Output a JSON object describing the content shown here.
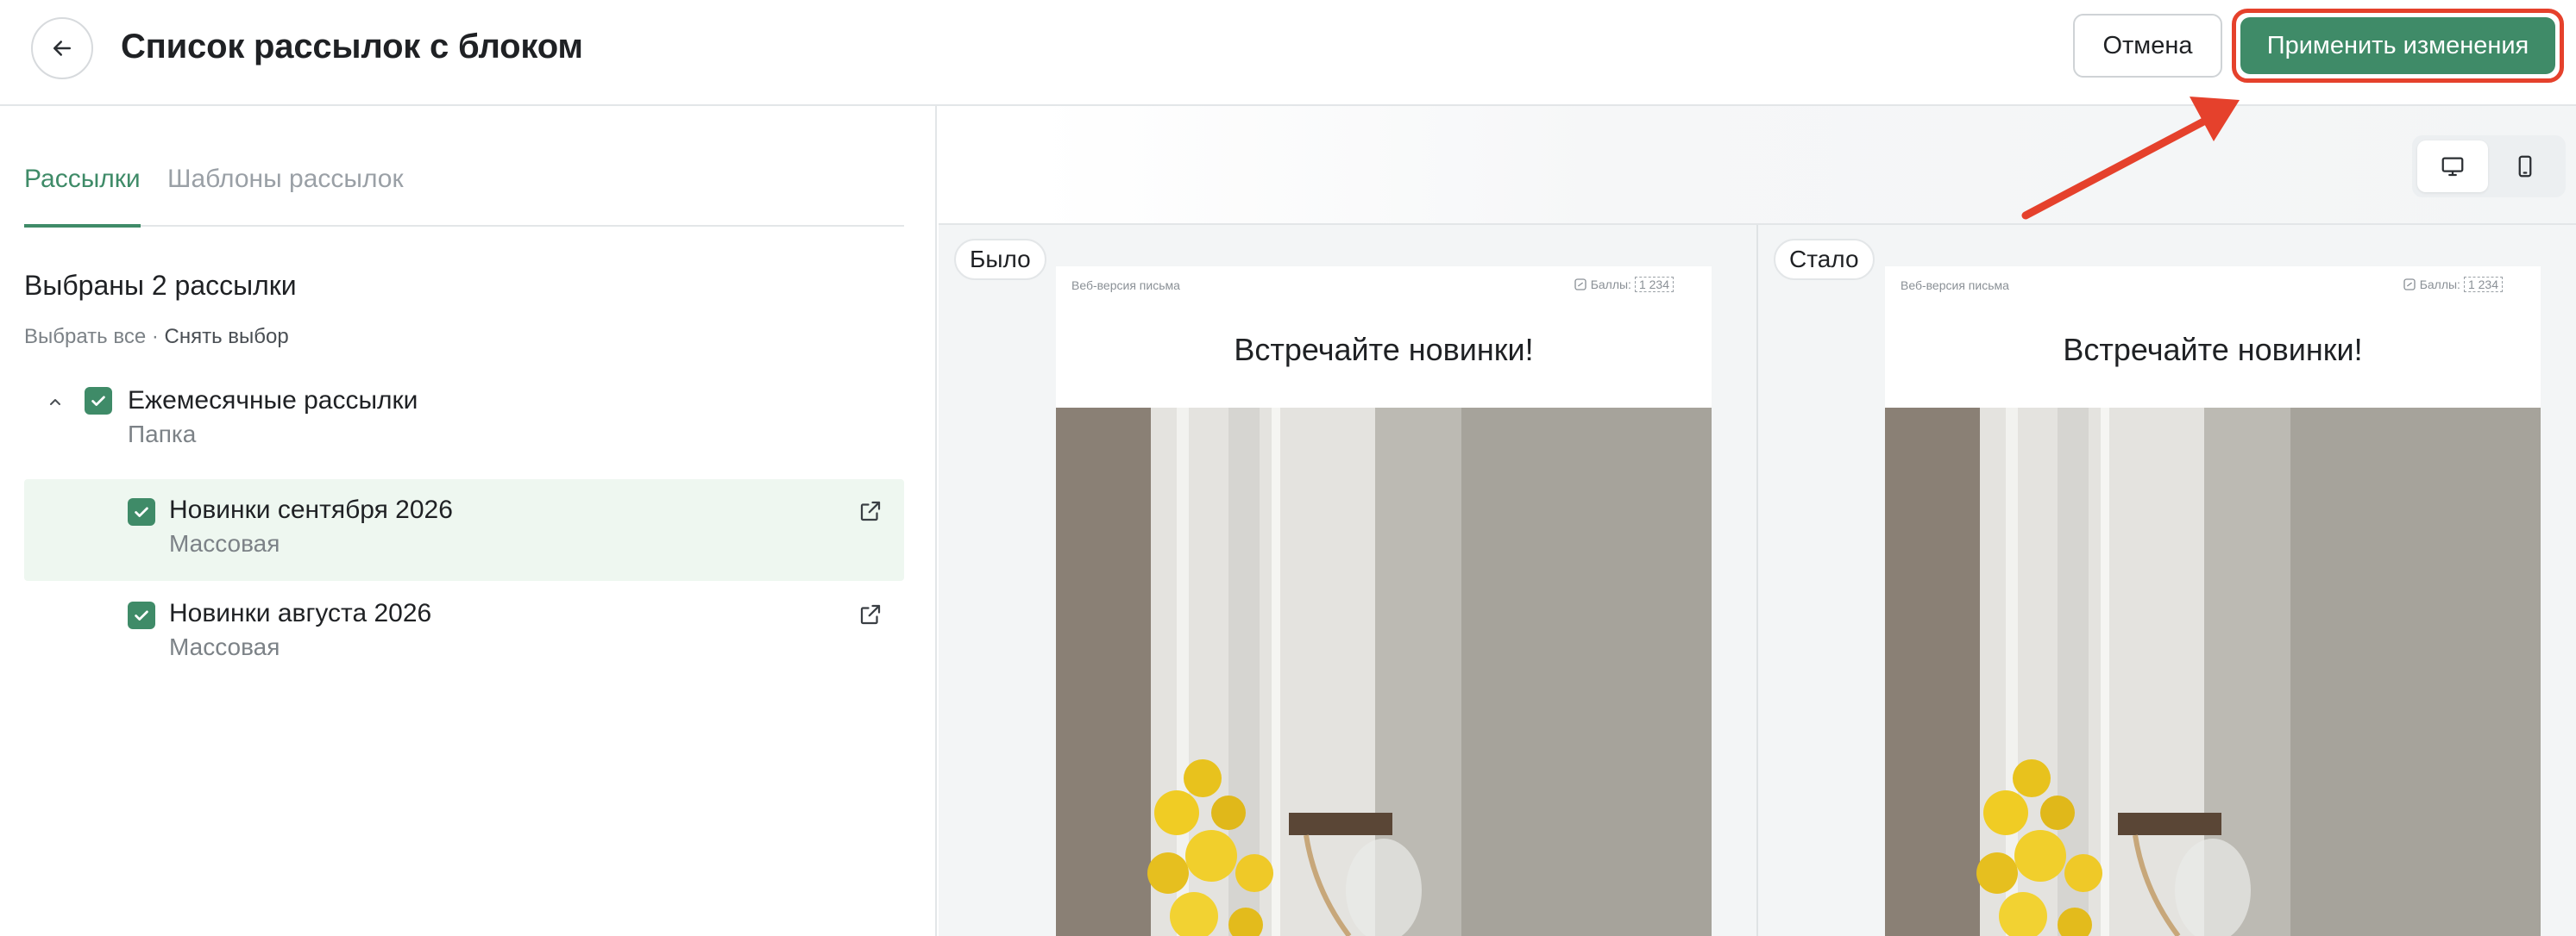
{
  "header": {
    "title": "Список рассылок с блоком",
    "cancel_label": "Отмена",
    "apply_label": "Применить изменения"
  },
  "tabs": [
    {
      "label": "Рассылки",
      "active": true
    },
    {
      "label": "Шаблоны рассылок",
      "active": false
    }
  ],
  "selection": {
    "title": "Выбраны 2 рассылки",
    "select_all": "Выбрать все",
    "separator": " · ",
    "clear": "Снять выбор"
  },
  "folder": {
    "title": "Ежемесячные рассылки",
    "subtitle": "Папка",
    "checked": true,
    "expanded": true
  },
  "campaigns": [
    {
      "title": "Новинки сентября 2026",
      "subtitle": "Массовая",
      "checked": true
    },
    {
      "title": "Новинки августа 2026",
      "subtitle": "Массовая",
      "checked": true
    }
  ],
  "preview": {
    "before_label": "Было",
    "after_label": "Стало",
    "device_selected": "desktop",
    "email": {
      "web_version": "Веб-версия письма",
      "points_label": "Баллы:",
      "points_value": "1 234",
      "heading": "Встречайте новинки!"
    }
  },
  "colors": {
    "accent": "#3f8b68",
    "highlight_row": "#eef7f0",
    "annotation": "#e5412c"
  }
}
